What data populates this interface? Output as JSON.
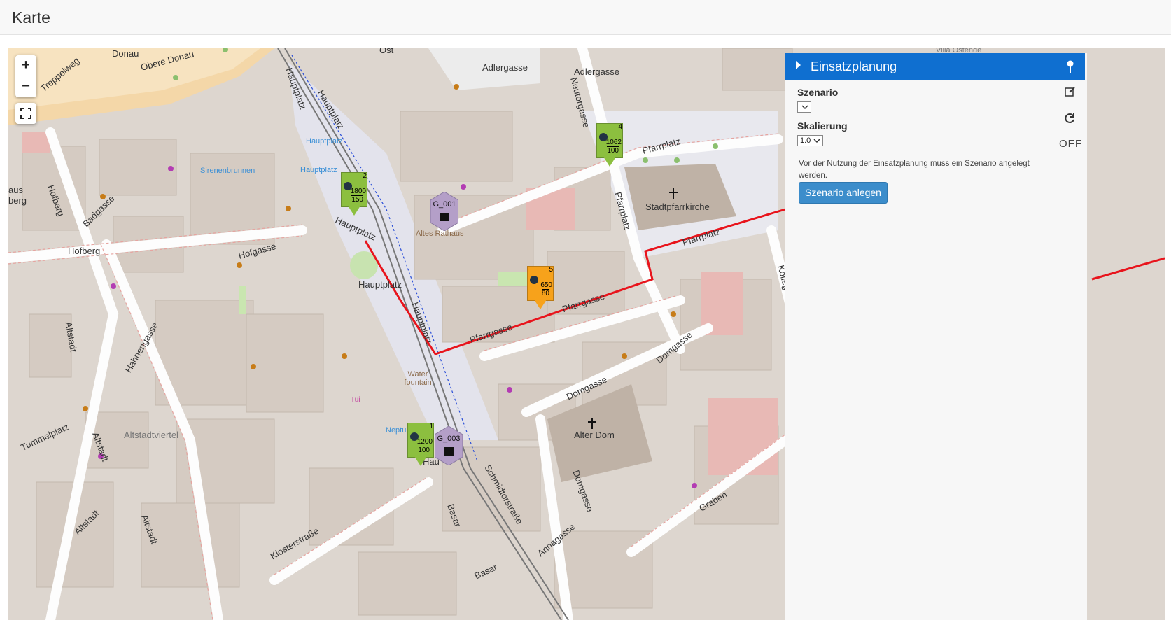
{
  "header": {
    "title": "Karte"
  },
  "map": {
    "zoom_in": "+",
    "zoom_out": "−",
    "labels": {
      "donau": "Donau",
      "obere_donau": "Obere Donau",
      "treppelweg": "Treppelweg",
      "ost": "Ost",
      "adlergasse1": "Adlergasse",
      "adlergasse2": "Adlergasse",
      "neutorgasse": "Neutorgasse",
      "villa": "Villa Ostende",
      "pfarrplatz1": "Pfarrplatz",
      "pfarrplatz2": "Pfarrplatz",
      "pfarrplatz3": "Pfarrplatz",
      "pfarrgasse1": "Pfarrgasse",
      "pfarrgasse2": "Pfarrgasse",
      "stadtpfarrkirche": "Stadtpfarrkirche",
      "hauptplatz1": "Hauptplatz",
      "hauptplatz2": "Hauptplatz",
      "hauptplatz3": "Hauptplatz",
      "hauptplatz4": "Hauptplatz",
      "hauptplatz5": "Hauptplatz",
      "hauptplatz6": "Hauptplatz",
      "hauptplatz7": "Hauptplatz",
      "sirenenbrunnen": "Sirenenbrunnen",
      "altes_rathaus": "Altes Rathaus",
      "hofberg1": "Hofberg",
      "hofberg2": "Hofberg",
      "badgasse": "Badgasse",
      "hofgasse": "Hofgasse",
      "altstadt1": "Altstadt",
      "altstadt2": "Altstadt",
      "altstadt3": "Altstadt",
      "altstadt4": "Altstadt",
      "hahnengasse": "Hahnengasse",
      "altstadtviertel": "Altstadtviertel",
      "tummelplatz": "Tummelplatz",
      "water_fountain": "Water fountain",
      "neptun": "Neptu",
      "tui": "Tui",
      "klosterstrasse": "Klosterstraße",
      "schmidtorstrasse": "Schmidtorstraße",
      "basar1": "Basar",
      "basar2": "Basar",
      "domgasse1": "Domgasse",
      "domgasse2": "Domgasse",
      "domgasse3": "Domgasse",
      "alter_dom": "Alter Dom",
      "annagasse": "Annagasse",
      "graben": "Graben",
      "kolleg": "Kolleg",
      "aus": "aus",
      "berg": "berg",
      "hau": "Hau"
    },
    "markers": [
      {
        "count": "2",
        "v1": "1800",
        "v2": "150",
        "color": "#8cbf3f"
      },
      {
        "count": "4",
        "v1": "1062",
        "v2": "100",
        "color": "#8cbf3f"
      },
      {
        "count": "5",
        "v1": "650",
        "v2": "80",
        "color": "#f7a21b"
      },
      {
        "count": "1",
        "v1": "1200",
        "v2": "100",
        "color": "#8cbf3f"
      }
    ],
    "groups": [
      {
        "label": "G_001"
      },
      {
        "label": "G_003"
      }
    ],
    "colors": {
      "route": "#e8141c",
      "road_casing": "#e6a4a0",
      "building": "#d9cfc7"
    }
  },
  "panel": {
    "title": "Einsatzplanung",
    "szenario_label": "Szenario",
    "szenario_value": "",
    "skalierung_label": "Skalierung",
    "skalierung_value": "1.0",
    "note": "Vor der Nutzung der Einsatzplanung muss ein Szenario angelegt werden.",
    "create_button": "Szenario anlegen",
    "toggle_state": "OFF",
    "accent": "#0f6fd0"
  }
}
